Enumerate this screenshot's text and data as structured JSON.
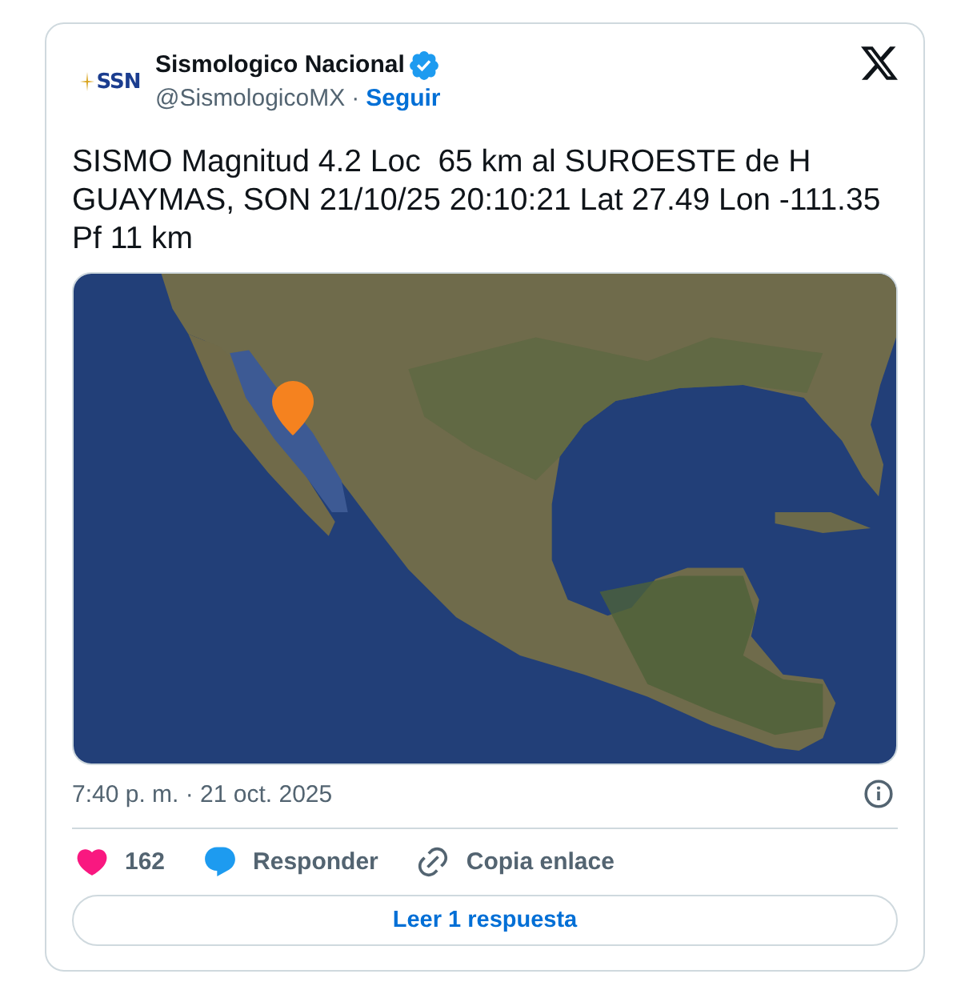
{
  "header": {
    "avatar": {
      "logo_text": "SSN"
    },
    "name": "Sismologico Nacional",
    "verified": true,
    "handle": "@SismologicoMX",
    "separator": "·",
    "follow": "Seguir"
  },
  "text": "SISMO Magnitud 4.2 Loc  65 km al SUROESTE de H GUAYMAS, SON 21/10/25 20:10:21 Lat 27.49 Lon -111.35 Pf 11 km",
  "timestamp": "7:40 p. m. · 21 oct. 2025",
  "actions": [
    {
      "kind": "like",
      "label": "162"
    },
    {
      "kind": "reply",
      "label": "Responder"
    },
    {
      "kind": "copy_link",
      "label": "Copia enlace"
    }
  ],
  "read_replies": "Leer 1 respuesta"
}
